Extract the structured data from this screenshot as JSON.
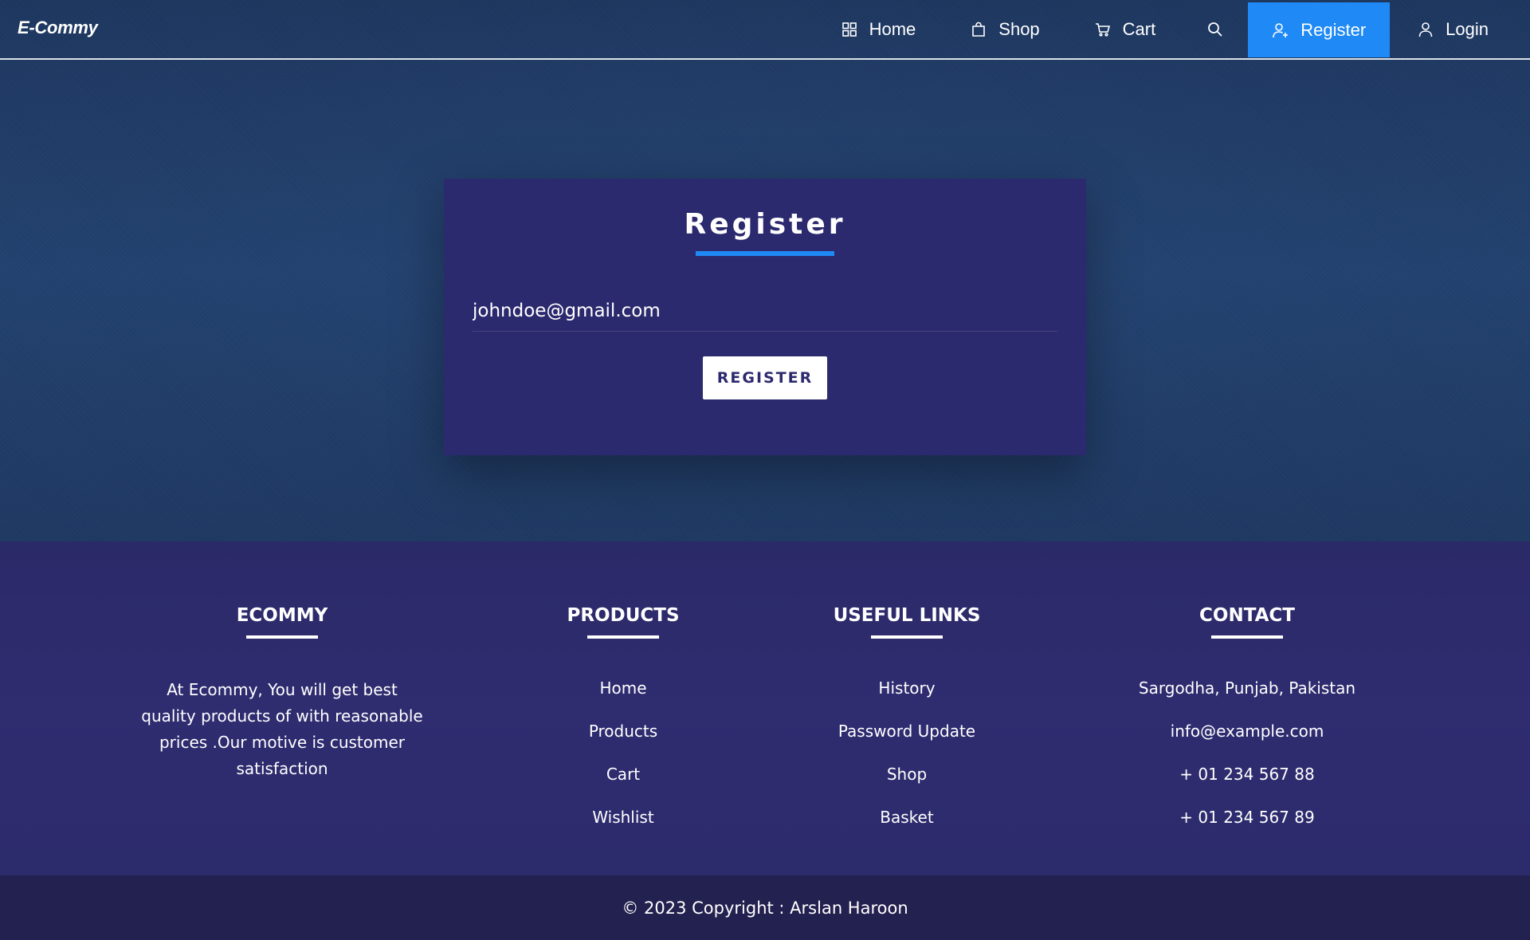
{
  "brand": "E-Commy",
  "nav": {
    "home": "Home",
    "shop": "Shop",
    "cart": "Cart",
    "register": "Register",
    "login": "Login"
  },
  "icons": {
    "home": "grid-icon",
    "shop": "shopping-bag-icon",
    "cart": "cart-icon",
    "search": "search-icon",
    "register": "user-add-icon",
    "login": "user-icon"
  },
  "colors": {
    "accent": "#1f8af5",
    "card": "#2c2a6e",
    "footer": "#2c2b6c",
    "copyright_bar": "#23214f"
  },
  "register_form": {
    "title": "Register",
    "email_value": "johndoe@gmail.com",
    "submit_label": "REGISTER"
  },
  "footer": {
    "about": {
      "heading": "ECOMMY",
      "text": "At Ecommy, You will get best quality products of with reasonable prices .Our motive is customer satisfaction"
    },
    "products": {
      "heading": "PRODUCTS",
      "links": [
        "Home",
        "Products",
        "Cart",
        "Wishlist"
      ]
    },
    "useful_links": {
      "heading": "USEFUL LINKS",
      "links": [
        "History",
        "Password Update",
        "Shop",
        "Basket"
      ]
    },
    "contact": {
      "heading": "CONTACT",
      "items": [
        "Sargodha, Punjab, Pakistan",
        "info@example.com",
        "+ 01 234 567 88",
        "+ 01 234 567 89"
      ]
    }
  },
  "copyright": "© 2023 Copyright : Arslan Haroon"
}
